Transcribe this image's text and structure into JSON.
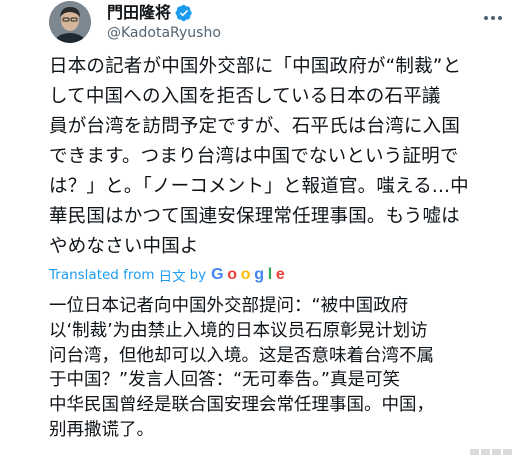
{
  "header": {
    "display_name": "門田隆将",
    "handle": "@KadotaRyusho",
    "avatar_icon": "user-avatar",
    "verified_icon": "verified-badge-icon",
    "more_icon": "more-options-icon"
  },
  "tweet": {
    "text": "日本の記者が中国外交部に「中国政府が“制裁”と\nして中国への入国を拒否している日本の石平議\n員が台湾を訪問予定ですが、石平氏は台湾に入国\nできます。つまり台湾は中国でないという証明で\nは？」と。「ノーコメント」と報道官。嗤える...中\n華民国はかつて国連安保理常任理事国。もう嘘は\nやめなさい中国よ"
  },
  "translation": {
    "translated_from_label": "Translated from",
    "source_language": "日文",
    "by_label": "by",
    "provider": "Google",
    "text": "一位日本记者向中国外交部提问：“被中国政府\n以‘制裁’为由禁止入境的日本议员石原彰晃计划访\n问台湾，但他却可以入境。这是否意味着台湾不属\n于中国？”发言人回答：“无可奉告。”真是可笑\n中华民国曾经是联合国安理会常任理事国。中国，\n别再撒谎了。"
  },
  "colors": {
    "verified_blue": "#1d9bf0",
    "link_blue": "#1d9bf0",
    "text_primary": "#0f1419",
    "text_secondary": "#536471",
    "google_blue": "#4285f4",
    "google_red": "#ea4335",
    "google_yellow": "#fbbc05",
    "google_green": "#34a853"
  }
}
